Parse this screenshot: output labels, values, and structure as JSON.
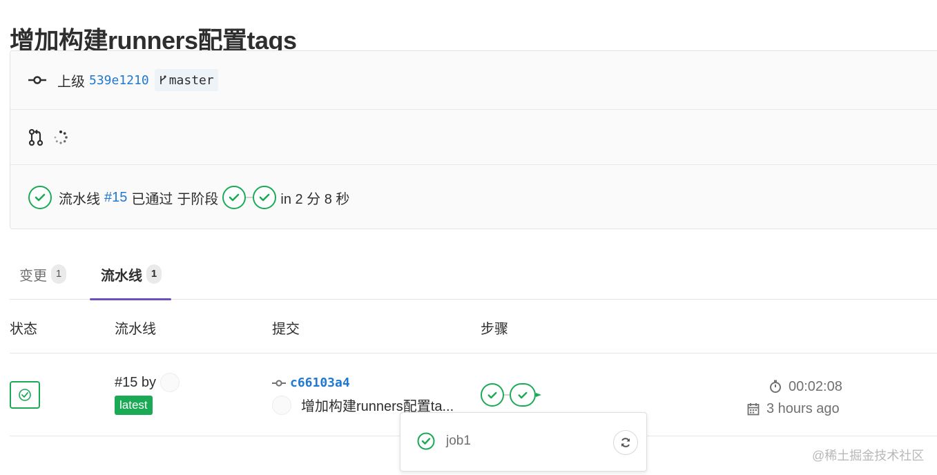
{
  "page": {
    "title": "增加构建runners配置tags"
  },
  "info": {
    "parent_label": "上级",
    "parent_sha": "539e1210",
    "branch": "master",
    "pipeline_prefix": "流水线",
    "pipeline_id": "#15",
    "pipeline_passed": "已通过",
    "pipeline_stage_label": "于阶段",
    "pipeline_duration": "in 2 分 8 秒"
  },
  "tabs": [
    {
      "label": "变更",
      "count": "1",
      "active": false
    },
    {
      "label": "流水线",
      "count": "1",
      "active": true
    }
  ],
  "table": {
    "headers": [
      "状态",
      "流水线",
      "提交",
      "步骤"
    ],
    "row": {
      "pipeline_id": "#15 by",
      "badge": "latest",
      "commit_sha": "c66103a4",
      "commit_message": "增加构建runners配置ta...",
      "duration": "00:02:08",
      "finished": "3 hours ago"
    }
  },
  "dropdown": {
    "job_name": "job1"
  },
  "watermark": "@稀土掘金技术社区",
  "colors": {
    "success": "#1aaa55",
    "link": "#1f78d1",
    "tab_active": "#6b4fbb"
  },
  "icons": [
    "commit-icon",
    "branch-icon",
    "merge-request-icon",
    "loading-spinner-icon",
    "status-success-icon",
    "timer-icon",
    "calendar-icon",
    "retry-icon"
  ]
}
